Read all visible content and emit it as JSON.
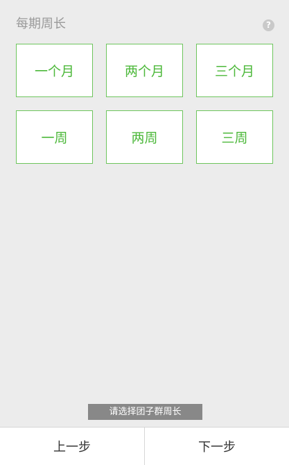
{
  "header": {
    "title": "每期周长",
    "help_icon": "question-mark-icon",
    "help_glyph": "?"
  },
  "options": [
    {
      "label": "一个月"
    },
    {
      "label": "两个月"
    },
    {
      "label": "三个月"
    },
    {
      "label": "一周"
    },
    {
      "label": "两周"
    },
    {
      "label": "三周"
    }
  ],
  "toast": {
    "message": "请选择团子群周长"
  },
  "footer": {
    "prev_label": "上一步",
    "next_label": "下一步"
  },
  "colors": {
    "accent": "#4cb83a",
    "border": "#6dc55c",
    "background": "#ececec",
    "toast_bg": "#888888"
  }
}
